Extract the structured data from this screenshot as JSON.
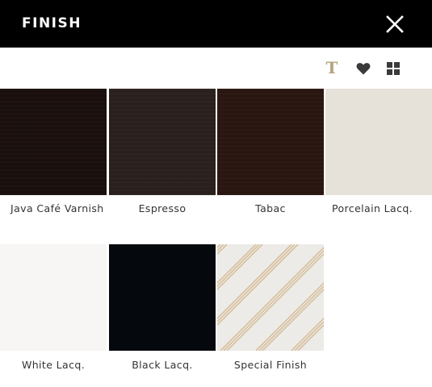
{
  "header": {
    "title": "FINISH",
    "close_icon": "close-icon"
  },
  "toolbar": {
    "text_tool_glyph": "T",
    "text_tool_color": "#b5a47f",
    "heart_color": "#3a3a3a",
    "grid_color": "#3a3a3a"
  },
  "finishes": [
    {
      "label": "Java Café Varnish",
      "color": "#1a0f0d"
    },
    {
      "label": "Espresso",
      "color": "#2a201d"
    },
    {
      "label": "Tabac",
      "color": "#2a1610"
    },
    {
      "label": "Porcelain Lacq.",
      "color": "#e6e2da"
    },
    {
      "label": "White Lacq.",
      "color": "#f7f6f4"
    },
    {
      "label": "Black Lacq.",
      "color": "#05090e"
    },
    {
      "label": "Special Finish",
      "color": "#ecebe8",
      "stripe_color": "#d7bf9c"
    }
  ]
}
